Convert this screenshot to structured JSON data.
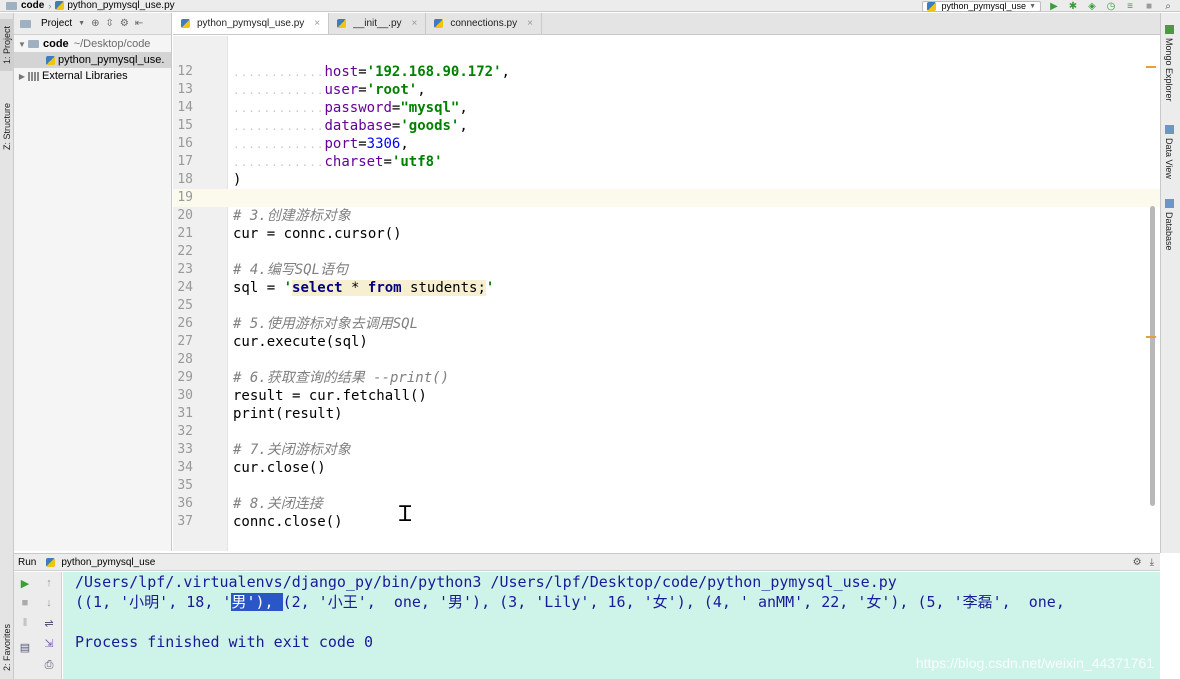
{
  "breadcrumb": {
    "root": "code",
    "file": "python_pymysql_use.py"
  },
  "toolbar": {
    "run_config": "python_pymysql_use"
  },
  "left_tabs": {
    "project": "1: Project",
    "structure": "Z: Structure",
    "favorites": "2: Favorites"
  },
  "right_tabs": {
    "mongo": "Mongo Explorer",
    "dataview": "Data View",
    "database": "Database"
  },
  "project_panel": {
    "header_label": "Project",
    "root_name": "code",
    "root_path": "~/Desktop/code",
    "file_item": "python_pymysql_use.",
    "libraries": "External Libraries"
  },
  "editor_tabs": [
    {
      "label": "python_pymysql_use.py"
    },
    {
      "label": "__init__.py"
    },
    {
      "label": "connections.py"
    }
  ],
  "code": {
    "l12": {
      "num": "12",
      "dots": "............",
      "name": "host",
      "val": "'192.168.90.172'",
      "tail": ","
    },
    "l13": {
      "num": "13",
      "dots": "............",
      "name": "user",
      "val": "'root'",
      "tail": ","
    },
    "l14": {
      "num": "14",
      "dots": "............",
      "name": "password",
      "val": "\"mysql\"",
      "tail": ","
    },
    "l15": {
      "num": "15",
      "dots": "............",
      "name": "database",
      "val": "'goods'",
      "tail": ","
    },
    "l16": {
      "num": "16",
      "dots": "............",
      "name": "port",
      "val": "3306",
      "tail": ","
    },
    "l17": {
      "num": "17",
      "dots": "............",
      "name": "charset",
      "val": "'utf8'"
    },
    "l18": {
      "num": "18",
      "text": ")"
    },
    "l19": {
      "num": "19"
    },
    "l20": {
      "num": "20",
      "text": "# 3.创建游标对象"
    },
    "l21": {
      "num": "21",
      "text": "cur = connc.cursor()"
    },
    "l22": {
      "num": "22"
    },
    "l23": {
      "num": "23",
      "text": "# 4.编写SQL语句"
    },
    "l24": {
      "num": "24",
      "pre": "sql = ",
      "q1": "'",
      "k1": "select",
      "mid1": " * ",
      "k2": "from",
      "mid2": " students;",
      "q2": "'"
    },
    "l25": {
      "num": "25"
    },
    "l26": {
      "num": "26",
      "text": "# 5.使用游标对象去调用SQL"
    },
    "l27": {
      "num": "27",
      "text": "cur.execute(sql)"
    },
    "l28": {
      "num": "28"
    },
    "l29": {
      "num": "29",
      "text": "# 6.获取查询的结果 --print()"
    },
    "l30": {
      "num": "30",
      "text": "result = cur.fetchall()"
    },
    "l31": {
      "num": "31",
      "text": "print(result)"
    },
    "l32": {
      "num": "32"
    },
    "l33": {
      "num": "33",
      "text": "# 7.关闭游标对象"
    },
    "l34": {
      "num": "34",
      "text": "cur.close()"
    },
    "l35": {
      "num": "35"
    },
    "l36": {
      "num": "36",
      "text": "# 8.关闭连接"
    },
    "l37": {
      "num": "37",
      "text": "connc.close()"
    }
  },
  "run": {
    "label": "Run",
    "config": "python_pymysql_use",
    "cmd": "/Users/lpf/.virtualenvs/django_py/bin/python3 /Users/lpf/Desktop/code/python_pymysql_use.py",
    "out_pre": "((1, '小明', 18, '",
    "out_sel": "男'), ",
    "out_post": "(2, '小王',  one, '男'), (3, 'Lily', 16, '女'), (4, ' anMM', 22, '女'), (5, '李磊',  one,",
    "finish": "Process finished with exit code 0"
  },
  "watermark": "https://blog.csdn.net/weixin_44371761"
}
